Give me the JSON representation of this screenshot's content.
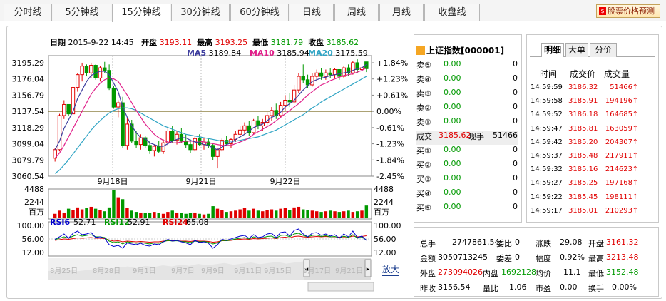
{
  "tabs": [
    "分时线",
    "5分钟线",
    "15分钟线",
    "30分钟线",
    "60分钟线",
    "日线",
    "周线",
    "月线",
    "收盘线"
  ],
  "active_tab": 2,
  "predict_button": "股票价格预测",
  "predict_icon": "stock-icon",
  "header": {
    "date_label": "日期",
    "date_value": "2015-9-22 14:45",
    "open_label": "开盘",
    "open_value": "3193.11",
    "high_label": "最高",
    "high_value": "3193.25",
    "low_label": "最低",
    "low_value": "3181.79",
    "close_label": "收盘",
    "close_value": "3185.62"
  },
  "ma": {
    "ma5_label": "MA5",
    "ma5": "3189.84",
    "ma10_label": "MA10",
    "ma10": "3185.94",
    "ma20_label": "MA20",
    "ma20": "3175.59"
  },
  "colors": {
    "up": "#e00000",
    "down": "#009900",
    "ma5": "#3d3d9e",
    "ma10": "#e0208a",
    "ma20": "#2fa4c4",
    "rsi6": "#0000cc",
    "rsi12": "#009900",
    "rsi24": "#e00000"
  },
  "chart_data": {
    "type": "candlestick",
    "y_ticks": [
      "3195.29",
      "3176.04",
      "3156.79",
      "3137.54",
      "3118.29",
      "3099.04",
      "3079.79",
      "3060.54"
    ],
    "pct_ticks": [
      "+1.84%",
      "+1.23%",
      "+0.61%",
      "0.00%",
      "-0.61%",
      "-1.23%",
      "-1.84%",
      "-2.45%"
    ],
    "x_ticks": [
      "9月18日",
      "9月21日",
      "9月22日"
    ],
    "ylim": [
      3060.54,
      3195.29
    ],
    "candles": [
      [
        3080,
        3092,
        3076,
        3090
      ],
      [
        3090,
        3132,
        3088,
        3130
      ],
      [
        3130,
        3148,
        3126,
        3143
      ],
      [
        3143,
        3138,
        3130,
        3132
      ],
      [
        3132,
        3165,
        3130,
        3163
      ],
      [
        3163,
        3180,
        3158,
        3178
      ],
      [
        3178,
        3192,
        3170,
        3188
      ],
      [
        3188,
        3190,
        3176,
        3180
      ],
      [
        3180,
        3192,
        3174,
        3189
      ],
      [
        3189,
        3190,
        3172,
        3174
      ],
      [
        3174,
        3188,
        3170,
        3186
      ],
      [
        3186,
        3193,
        3180,
        3183
      ],
      [
        3183,
        3190,
        3160,
        3162
      ],
      [
        3162,
        3165,
        3138,
        3140
      ],
      [
        3140,
        3148,
        3128,
        3145
      ],
      [
        3145,
        3152,
        3092,
        3095
      ],
      [
        3095,
        3128,
        3090,
        3120
      ],
      [
        3120,
        3125,
        3098,
        3100
      ],
      [
        3100,
        3112,
        3092,
        3096
      ],
      [
        3096,
        3108,
        3090,
        3104
      ],
      [
        3104,
        3106,
        3092,
        3095
      ],
      [
        3095,
        3100,
        3085,
        3089
      ],
      [
        3089,
        3096,
        3082,
        3094
      ],
      [
        3094,
        3100,
        3086,
        3088
      ],
      [
        3088,
        3102,
        3085,
        3098
      ],
      [
        3098,
        3115,
        3094,
        3112
      ],
      [
        3112,
        3118,
        3098,
        3101
      ],
      [
        3101,
        3112,
        3096,
        3108
      ],
      [
        3108,
        3115,
        3098,
        3100
      ],
      [
        3100,
        3108,
        3092,
        3096
      ],
      [
        3096,
        3102,
        3086,
        3090
      ],
      [
        3090,
        3106,
        3088,
        3103
      ],
      [
        3103,
        3108,
        3094,
        3096
      ],
      [
        3096,
        3104,
        3090,
        3099
      ],
      [
        3099,
        3104,
        3092,
        3095
      ],
      [
        3095,
        3098,
        3078,
        3082
      ],
      [
        3082,
        3092,
        3068,
        3090
      ],
      [
        3090,
        3103,
        3088,
        3101
      ],
      [
        3101,
        3106,
        3094,
        3097
      ],
      [
        3097,
        3104,
        3092,
        3102
      ],
      [
        3102,
        3112,
        3099,
        3108
      ],
      [
        3108,
        3118,
        3104,
        3113
      ],
      [
        3113,
        3122,
        3108,
        3118
      ],
      [
        3118,
        3124,
        3106,
        3110
      ],
      [
        3110,
        3126,
        3108,
        3124
      ],
      [
        3124,
        3130,
        3114,
        3118
      ],
      [
        3118,
        3126,
        3112,
        3122
      ],
      [
        3122,
        3134,
        3118,
        3130
      ],
      [
        3130,
        3140,
        3124,
        3136
      ],
      [
        3136,
        3144,
        3126,
        3130
      ],
      [
        3130,
        3146,
        3128,
        3142
      ],
      [
        3142,
        3154,
        3136,
        3148
      ],
      [
        3148,
        3156,
        3140,
        3146
      ],
      [
        3146,
        3166,
        3144,
        3160
      ],
      [
        3160,
        3180,
        3156,
        3176
      ],
      [
        3176,
        3190,
        3168,
        3172
      ],
      [
        3172,
        3178,
        3162,
        3166
      ],
      [
        3166,
        3180,
        3164,
        3176
      ],
      [
        3176,
        3184,
        3170,
        3180
      ],
      [
        3180,
        3186,
        3172,
        3176
      ],
      [
        3176,
        3184,
        3172,
        3180
      ],
      [
        3180,
        3186,
        3174,
        3178
      ],
      [
        3178,
        3186,
        3174,
        3184
      ],
      [
        3184,
        3184,
        3172,
        3176
      ],
      [
        3176,
        3188,
        3174,
        3186
      ],
      [
        3186,
        3190,
        3176,
        3180
      ],
      [
        3180,
        3194,
        3178,
        3192
      ],
      [
        3192,
        3196,
        3180,
        3184
      ],
      [
        3184,
        3192,
        3178,
        3186
      ],
      [
        3193,
        3193,
        3181,
        3185
      ]
    ],
    "ma5": [
      3090,
      3100,
      3115,
      3125,
      3135,
      3150,
      3160,
      3170,
      3177,
      3180,
      3182,
      3182,
      3178,
      3168,
      3158,
      3140,
      3128,
      3118,
      3110,
      3104,
      3103,
      3098,
      3096,
      3094,
      3094,
      3097,
      3100,
      3102,
      3104,
      3104,
      3101,
      3099,
      3098,
      3096,
      3095,
      3092,
      3090,
      3093,
      3096,
      3098,
      3102,
      3105,
      3108,
      3112,
      3116,
      3118,
      3120,
      3124,
      3128,
      3130,
      3134,
      3140,
      3144,
      3148,
      3154,
      3160,
      3165,
      3170,
      3172,
      3174,
      3175,
      3177,
      3178,
      3179,
      3180,
      3181,
      3183,
      3185,
      3186,
      3190
    ],
    "ma10": [
      3080,
      3086,
      3095,
      3105,
      3115,
      3125,
      3135,
      3145,
      3155,
      3162,
      3168,
      3172,
      3174,
      3173,
      3170,
      3162,
      3154,
      3145,
      3136,
      3128,
      3120,
      3114,
      3108,
      3104,
      3101,
      3099,
      3098,
      3098,
      3099,
      3100,
      3100,
      3100,
      3100,
      3099,
      3098,
      3097,
      3096,
      3095,
      3095,
      3095,
      3097,
      3099,
      3101,
      3104,
      3108,
      3111,
      3114,
      3117,
      3120,
      3124,
      3128,
      3132,
      3136,
      3140,
      3144,
      3149,
      3154,
      3158,
      3162,
      3166,
      3168,
      3171,
      3173,
      3175,
      3177,
      3178,
      3179,
      3181,
      3183,
      3186
    ],
    "ma20": [
      3062,
      3066,
      3072,
      3078,
      3085,
      3092,
      3099,
      3106,
      3113,
      3119,
      3124,
      3129,
      3133,
      3136,
      3138,
      3139,
      3139,
      3138,
      3136,
      3133,
      3130,
      3127,
      3124,
      3121,
      3118,
      3116,
      3114,
      3112,
      3110,
      3108,
      3107,
      3106,
      3105,
      3104,
      3103,
      3102,
      3101,
      3100,
      3100,
      3100,
      3100,
      3101,
      3102,
      3103,
      3104,
      3105,
      3107,
      3109,
      3111,
      3113,
      3116,
      3119,
      3122,
      3125,
      3128,
      3131,
      3135,
      3139,
      3142,
      3146,
      3149,
      3152,
      3155,
      3158,
      3161,
      3164,
      3167,
      3170,
      3173,
      3176
    ],
    "vol_ticks": [
      "4488",
      "2244",
      "百万"
    ],
    "volumes": [
      700,
      1200,
      900,
      1500,
      1300,
      1700,
      1400,
      1600,
      1800,
      1500,
      1300,
      1100,
      1700,
      4488,
      3300,
      3000,
      1600,
      1200,
      1000,
      900,
      800,
      900,
      1000,
      800,
      700,
      1000,
      1200,
      900,
      800,
      700,
      800,
      900,
      700,
      600,
      700,
      1900,
      1500,
      1300,
      1000,
      1100,
      1200,
      1400,
      1600,
      1200,
      1500,
      1200,
      1100,
      1300,
      1400,
      1200,
      1500,
      1600,
      1300,
      1700,
      1800,
      1400,
      1300,
      1200,
      1100,
      1000,
      1100,
      1200,
      1100,
      1000,
      1100,
      1200,
      1000,
      1100,
      1200,
      2000
    ],
    "rsi_ticks": [
      "100.00",
      "56.00",
      "12.00"
    ],
    "rsi6_label": "RSI6",
    "rsi6_value": "52.71",
    "rsi12_label": "RSI12",
    "rsi12_value": "52.91",
    "rsi24_label": "RSI24",
    "rsi24_value": "65.08",
    "rsi6": [
      55,
      62,
      70,
      58,
      72,
      78,
      68,
      70,
      74,
      60,
      62,
      58,
      40,
      35,
      38,
      30,
      45,
      42,
      40,
      44,
      38,
      36,
      42,
      40,
      48,
      55,
      50,
      52,
      48,
      45,
      40,
      52,
      46,
      48,
      44,
      30,
      40,
      55,
      52,
      56,
      60,
      64,
      66,
      58,
      68,
      60,
      62,
      70,
      72,
      60,
      74,
      76,
      64,
      80,
      84,
      70,
      62,
      72,
      74,
      66,
      70,
      64,
      68,
      58,
      70,
      62,
      78,
      60,
      64,
      52
    ],
    "rsi12": [
      54,
      58,
      62,
      58,
      64,
      68,
      64,
      66,
      68,
      62,
      62,
      60,
      50,
      46,
      48,
      42,
      48,
      46,
      44,
      46,
      44,
      42,
      45,
      44,
      48,
      52,
      50,
      51,
      49,
      48,
      46,
      50,
      48,
      49,
      47,
      42,
      45,
      52,
      51,
      53,
      56,
      58,
      60,
      56,
      62,
      58,
      59,
      63,
      64,
      58,
      66,
      67,
      62,
      70,
      72,
      66,
      62,
      66,
      67,
      63,
      65,
      62,
      63,
      59,
      64,
      60,
      68,
      58,
      61,
      53
    ],
    "rsi24": [
      52,
      54,
      56,
      55,
      57,
      59,
      58,
      59,
      60,
      58,
      58,
      57,
      53,
      50,
      51,
      48,
      50,
      49,
      48,
      49,
      48,
      47,
      48,
      48,
      50,
      51,
      51,
      51,
      50,
      50,
      49,
      51,
      50,
      50,
      49,
      47,
      48,
      51,
      51,
      52,
      54,
      55,
      56,
      55,
      57,
      56,
      57,
      58,
      59,
      57,
      60,
      61,
      59,
      63,
      64,
      62,
      61,
      62,
      63,
      62,
      63,
      62,
      62,
      61,
      62,
      61,
      64,
      62,
      63,
      65
    ],
    "nav_ticks": [
      "8月25日",
      "8月28日",
      "9月1日",
      "9月7日",
      "9月9日",
      "9月11日",
      "9月15日",
      "9月17日",
      "9月21日"
    ],
    "nav_series": [
      30,
      34,
      40,
      28,
      32,
      36,
      44,
      38,
      42,
      46,
      40,
      48,
      44,
      50,
      46,
      52,
      48,
      55,
      50,
      54,
      58,
      52,
      56,
      60,
      54,
      58,
      62,
      56,
      60,
      64
    ]
  },
  "zoom_button": "放大",
  "orderbook": {
    "title": "上证指数[000001]",
    "rows": [
      {
        "label": "卖⑤",
        "price": "0.00",
        "vol": "0"
      },
      {
        "label": "卖④",
        "price": "0.00",
        "vol": "0"
      },
      {
        "label": "卖③",
        "price": "0.00",
        "vol": "0"
      },
      {
        "label": "卖②",
        "price": "0.00",
        "vol": "0"
      },
      {
        "label": "卖①",
        "price": "0.00",
        "vol": "0"
      },
      {
        "label": "成交",
        "price": "3185.62",
        "vol": "51466",
        "extra": "现手"
      },
      {
        "label": "买①",
        "price": "0.00",
        "vol": "0"
      },
      {
        "label": "买②",
        "price": "0.00",
        "vol": "0"
      },
      {
        "label": "买③",
        "price": "0.00",
        "vol": "0"
      },
      {
        "label": "买④",
        "price": "0.00",
        "vol": "0"
      },
      {
        "label": "买⑤",
        "price": "0.00",
        "vol": "0"
      }
    ]
  },
  "trades": {
    "tabs": [
      "明细",
      "大单",
      "分价"
    ],
    "headers": [
      "时间",
      "成交价",
      "成交量"
    ],
    "rows": [
      {
        "time": "14:59:59",
        "price": "3186.32",
        "vol": "51466"
      },
      {
        "time": "14:59:58",
        "price": "3185.91",
        "vol": "194196"
      },
      {
        "time": "14:59:52",
        "price": "3186.18",
        "vol": "164685"
      },
      {
        "time": "14:59:47",
        "price": "3185.81",
        "vol": "163059"
      },
      {
        "time": "14:59:42",
        "price": "3185.20",
        "vol": "204307"
      },
      {
        "time": "14:59:37",
        "price": "3185.48",
        "vol": "217911"
      },
      {
        "time": "14:59:32",
        "price": "3185.16",
        "vol": "214623"
      },
      {
        "time": "14:59:27",
        "price": "3185.25",
        "vol": "197168"
      },
      {
        "time": "14:59:22",
        "price": "3185.45",
        "vol": "198111"
      },
      {
        "time": "14:59:17",
        "price": "3185.01",
        "vol": "210293"
      }
    ]
  },
  "stats": {
    "zongshou_label": "总手",
    "zongshou": "2747861.54",
    "weibi_label": "委比",
    "weibi": "0",
    "zhangdie_label": "涨跌",
    "zhangdie": "29.08",
    "kaipan_label": "开盘",
    "kaipan": "3161.32",
    "jine_label": "金额",
    "jine": "3050713245",
    "weicha_label": "委差",
    "weicha": "0",
    "fudu_label": "幅度",
    "fudu": "0.92%",
    "zuigao_label": "最高",
    "zuigao": "3213.48",
    "waipan_label": "外盘",
    "waipan": "273094026",
    "neipan_label": "内盘",
    "neipan": "1692128",
    "junjia_label": "均价",
    "junjia": "11.1",
    "zuidi_label": "最低",
    "zuidi": "3152.48",
    "zuoshou_label": "昨收",
    "zuoshou": "3156.54",
    "liangbi_label": "量比",
    "liangbi": "1.06",
    "shiying_label": "市盈",
    "shiying": "0.00",
    "huanshou_label": "换手",
    "huanshou": "0.00%"
  }
}
